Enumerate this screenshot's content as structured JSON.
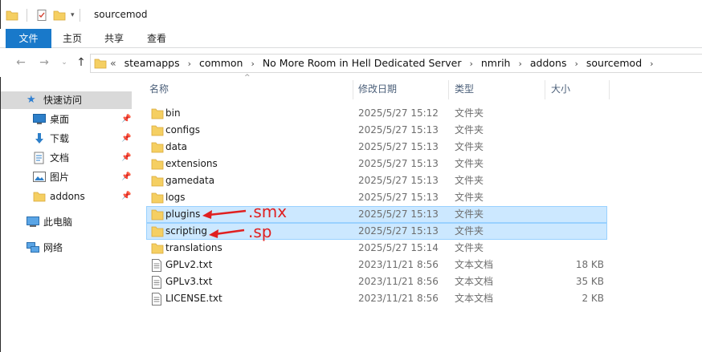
{
  "window": {
    "title": "sourcemod"
  },
  "ribbon": {
    "tabs": [
      "文件",
      "主页",
      "共享",
      "查看"
    ]
  },
  "address": {
    "overflow": "«",
    "crumbs": [
      "steamapps",
      "common",
      "No More Room in Hell Dedicated Server",
      "nmrih",
      "addons",
      "sourcemod"
    ]
  },
  "nav": {
    "quick_access": "快速访问",
    "pinned": [
      {
        "label": "桌面",
        "icon": "desktop-icon"
      },
      {
        "label": "下载",
        "icon": "download-icon"
      },
      {
        "label": "文档",
        "icon": "documents-icon"
      },
      {
        "label": "图片",
        "icon": "pictures-icon"
      },
      {
        "label": "addons",
        "icon": "folder-icon"
      }
    ],
    "this_pc": "此电脑",
    "network": "网络"
  },
  "columns": {
    "name": "名称",
    "date": "修改日期",
    "type": "类型",
    "size": "大小"
  },
  "files": [
    {
      "name": "bin",
      "date": "2025/5/27 15:12",
      "type": "文件夹",
      "size": "",
      "kind": "folder"
    },
    {
      "name": "configs",
      "date": "2025/5/27 15:13",
      "type": "文件夹",
      "size": "",
      "kind": "folder"
    },
    {
      "name": "data",
      "date": "2025/5/27 15:13",
      "type": "文件夹",
      "size": "",
      "kind": "folder"
    },
    {
      "name": "extensions",
      "date": "2025/5/27 15:13",
      "type": "文件夹",
      "size": "",
      "kind": "folder"
    },
    {
      "name": "gamedata",
      "date": "2025/5/27 15:13",
      "type": "文件夹",
      "size": "",
      "kind": "folder"
    },
    {
      "name": "logs",
      "date": "2025/5/27 15:13",
      "type": "文件夹",
      "size": "",
      "kind": "folder"
    },
    {
      "name": "plugins",
      "date": "2025/5/27 15:13",
      "type": "文件夹",
      "size": "",
      "kind": "folder",
      "selected": true
    },
    {
      "name": "scripting",
      "date": "2025/5/27 15:13",
      "type": "文件夹",
      "size": "",
      "kind": "folder",
      "selected": true
    },
    {
      "name": "translations",
      "date": "2025/5/27 15:14",
      "type": "文件夹",
      "size": "",
      "kind": "folder"
    },
    {
      "name": "GPLv2.txt",
      "date": "2023/11/21 8:56",
      "type": "文本文档",
      "size": "18 KB",
      "kind": "text"
    },
    {
      "name": "GPLv3.txt",
      "date": "2023/11/21 8:56",
      "type": "文本文档",
      "size": "35 KB",
      "kind": "text"
    },
    {
      "name": "LICENSE.txt",
      "date": "2023/11/21 8:56",
      "type": "文本文档",
      "size": "2 KB",
      "kind": "text"
    }
  ],
  "annotations": {
    "plugins": ".smx",
    "scripting": ".sp"
  },
  "colors": {
    "accent": "#1979ca",
    "selection": "#cce8ff",
    "selection_border": "#99d1ff",
    "annotation": "#e02020",
    "folder": "#f5cf62"
  }
}
